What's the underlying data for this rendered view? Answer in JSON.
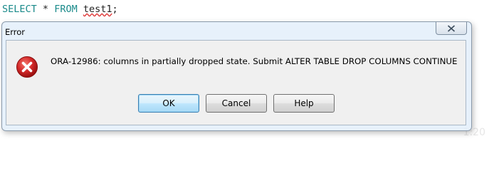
{
  "editor": {
    "sql_select": "SELECT",
    "sql_star": "*",
    "sql_from": "FROM",
    "sql_table": "test1",
    "sql_semicolon": ";",
    "corner_text": "1:20"
  },
  "dialog": {
    "title": "Error",
    "message": "ORA-12986: columns in partially dropped state. Submit ALTER TABLE DROP COLUMNS CONTINUE",
    "icon": "error-icon",
    "buttons": {
      "ok": "OK",
      "cancel": "Cancel",
      "help": "Help"
    }
  },
  "colors": {
    "sql_keyword": "#1a8a8a",
    "error_red": "#d42a2a",
    "dialog_frame": "#e2eefa",
    "default_button": "#bee6fd"
  }
}
